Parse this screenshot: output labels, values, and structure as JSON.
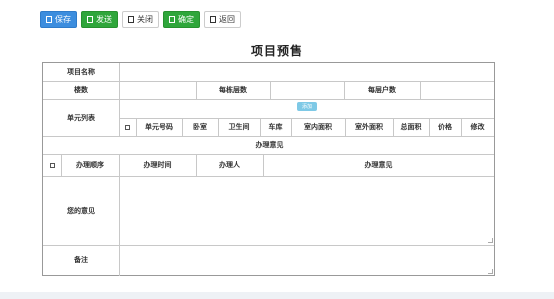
{
  "toolbar": {
    "save_label": "保存",
    "submit_label": "发送",
    "close_label": "关闭",
    "approve_label": "确定",
    "back_label": "返回"
  },
  "page_title": "项目预售",
  "form": {
    "project_name_label": "项目名称",
    "floors_label": "楼数",
    "floor_count_label": "每栋层数",
    "units_per_floor_label": "每层户数",
    "unit_list_label": "单元列表",
    "add_button_label": "添加",
    "unit_columns": [
      "单元号码",
      "卧室",
      "卫生间",
      "车库",
      "室内面积",
      "室外面积",
      "总面积",
      "价格",
      "修改"
    ],
    "opinion_section_title": "办理意见",
    "opinion_columns": [
      "办理顺序",
      "办理时间",
      "办理人",
      "办理意见"
    ],
    "your_opinion_label": "您的意见",
    "remark_label": "备注"
  }
}
